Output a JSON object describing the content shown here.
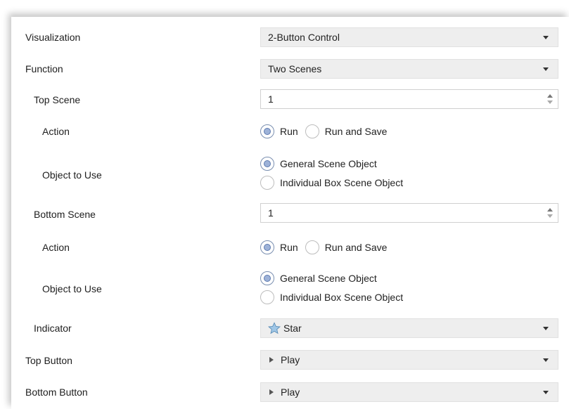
{
  "visualization": {
    "label": "Visualization",
    "value": "2-Button Control"
  },
  "function": {
    "label": "Function",
    "value": "Two Scenes"
  },
  "top_scene": {
    "label": "Top Scene",
    "value": "1",
    "action_label": "Action",
    "action_options": [
      "Run",
      "Run and Save"
    ],
    "action_selected": "Run",
    "object_label": "Object to Use",
    "object_options": [
      "General Scene Object",
      "Individual Box Scene Object"
    ],
    "object_selected": "General Scene Object"
  },
  "bottom_scene": {
    "label": "Bottom Scene",
    "value": "1",
    "action_label": "Action",
    "action_options": [
      "Run",
      "Run and Save"
    ],
    "action_selected": "Run",
    "object_label": "Object to Use",
    "object_options": [
      "General Scene Object",
      "Individual Box Scene Object"
    ],
    "object_selected": "General Scene Object"
  },
  "indicator": {
    "label": "Indicator",
    "value": "Star",
    "icon": "star-icon"
  },
  "top_button": {
    "label": "Top Button",
    "value": "Play",
    "icon": "play-icon"
  },
  "bottom_button": {
    "label": "Bottom Button",
    "value": "Play",
    "icon": "play-icon"
  },
  "colors": {
    "select_bg": "#eeeeee",
    "radio_accent": "#9db2d8",
    "star": "#9fc6e6"
  }
}
